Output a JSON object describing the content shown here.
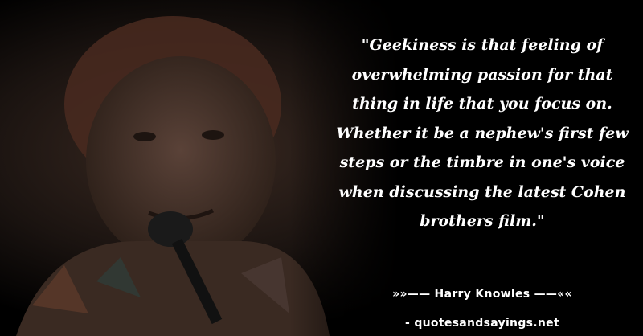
{
  "quote": {
    "lines": [
      "\"Geekiness is that feeling of",
      "overwhelming passion for that",
      "thing in life that you focus on.",
      "Whether it be a nephew's first few",
      "steps or the timbre in one's voice",
      "when discussing the latest Cohen",
      "brothers film.\""
    ]
  },
  "attribution": "»»—— Harry Knowles ——««",
  "source": "- quotesandsayings.net"
}
